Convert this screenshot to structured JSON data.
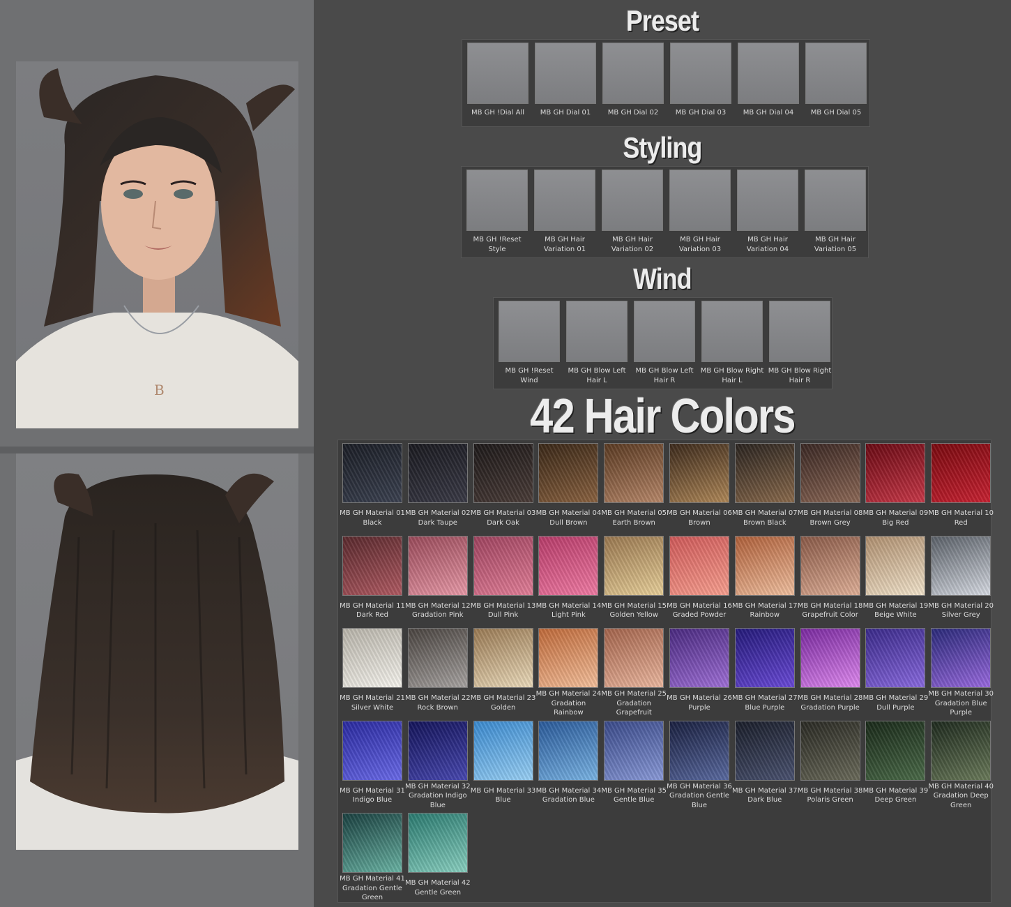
{
  "headings": {
    "preset": "Preset",
    "styling": "Styling",
    "wind": "Wind",
    "colors": "42 Hair Colors"
  },
  "preset": [
    {
      "label": "MB GH !Dial All"
    },
    {
      "label": "MB GH Dial 01"
    },
    {
      "label": "MB GH Dial 02"
    },
    {
      "label": "MB GH Dial 03"
    },
    {
      "label": "MB GH Dial 04"
    },
    {
      "label": "MB GH Dial 05"
    }
  ],
  "styling": [
    {
      "line1": "MB GH !Reset",
      "line2": "Style"
    },
    {
      "line1": "MB GH Hair",
      "line2": "Variation 01"
    },
    {
      "line1": "MB GH Hair",
      "line2": "Variation 02"
    },
    {
      "line1": "MB GH Hair",
      "line2": "Variation 03"
    },
    {
      "line1": "MB GH Hair",
      "line2": "Variation 04"
    },
    {
      "line1": "MB GH Hair",
      "line2": "Variation 05"
    }
  ],
  "wind": [
    {
      "line1": "MB GH !Reset",
      "line2": "Wind"
    },
    {
      "line1": "MB GH Blow Left",
      "line2": "Hair L"
    },
    {
      "line1": "MB GH Blow Left",
      "line2": "Hair R"
    },
    {
      "line1": "MB GH Blow Right",
      "line2": "Hair L"
    },
    {
      "line1": "MB GH Blow Right",
      "line2": "Hair R"
    }
  ],
  "colors": [
    {
      "lines": [
        "MB GH Material 01",
        "Black"
      ],
      "c1": "#1b1e26",
      "c2": "#3b4150"
    },
    {
      "lines": [
        "MB GH Material 02",
        "Dark Taupe"
      ],
      "c1": "#1a1a20",
      "c2": "#3a3a46"
    },
    {
      "lines": [
        "MB GH Material 03",
        "Dark Oak"
      ],
      "c1": "#1e1a1a",
      "c2": "#4a3c38"
    },
    {
      "lines": [
        "MB GH Material 04",
        "Dull Brown"
      ],
      "c1": "#3a2818",
      "c2": "#8a6240"
    },
    {
      "lines": [
        "MB GH Material 05",
        "Earth Brown"
      ],
      "c1": "#5a3a22",
      "c2": "#b8886a"
    },
    {
      "lines": [
        "MB GH Material 06",
        "Brown"
      ],
      "c1": "#3c2a1c",
      "c2": "#b08858"
    },
    {
      "lines": [
        "MB GH Material 07",
        "Brown Black"
      ],
      "c1": "#2a2420",
      "c2": "#8a6a4c"
    },
    {
      "lines": [
        "MB GH Material 08",
        "Brown Grey"
      ],
      "c1": "#3a2824",
      "c2": "#8c6856"
    },
    {
      "lines": [
        "MB GH Material 09",
        "Big Red"
      ],
      "c1": "#6a0a14",
      "c2": "#c83848"
    },
    {
      "lines": [
        "MB GH Material 10",
        "Red"
      ],
      "c1": "#7a0a10",
      "c2": "#c82232"
    },
    {
      "lines": [
        "MB GH Material 11",
        "Dark Red"
      ],
      "c1": "#5a2a2e",
      "c2": "#b05a62"
    },
    {
      "lines": [
        "MB GH Material 12",
        "Gradation Pink"
      ],
      "c1": "#9a4a5a",
      "c2": "#e89aa8"
    },
    {
      "lines": [
        "MB GH Material 13",
        "Dull Pink"
      ],
      "c1": "#a04460",
      "c2": "#e27f98"
    },
    {
      "lines": [
        "MB GH Material 14",
        "Light Pink"
      ],
      "c1": "#b83c6a",
      "c2": "#f07ca4"
    },
    {
      "lines": [
        "MB GH Material 15",
        "Golden Yellow"
      ],
      "c1": "#9a7850",
      "c2": "#e8d09a"
    },
    {
      "lines": [
        "MB GH Material 16",
        "Graded Powder"
      ],
      "c1": "#d05a5a",
      "c2": "#f8a090"
    },
    {
      "lines": [
        "MB GH Material 17",
        "Rainbow"
      ],
      "c1": "#b0603a",
      "c2": "#f0c0a0"
    },
    {
      "lines": [
        "MB GH Material 18",
        "Grapefruit Color"
      ],
      "c1": "#8a5a48",
      "c2": "#e0b098"
    },
    {
      "lines": [
        "MB GH Material 19",
        "Beige White"
      ],
      "c1": "#b09070",
      "c2": "#f2e4cc"
    },
    {
      "lines": [
        "MB GH Material 20",
        "Silver Grey"
      ],
      "c1": "#5a6068",
      "c2": "#d8dce4"
    },
    {
      "lines": [
        "MB GH Material 21",
        "Silver White"
      ],
      "c1": "#b8b4aa",
      "c2": "#f6f4ee"
    },
    {
      "lines": [
        "MB GH Material 22",
        "Rock Brown"
      ],
      "c1": "#4a4440",
      "c2": "#a8a4a2"
    },
    {
      "lines": [
        "MB GH Material 23",
        "Golden"
      ],
      "c1": "#9a7a54",
      "c2": "#ecdcbc"
    },
    {
      "lines": [
        "MB GH Material 24",
        "Gradation",
        "Rainbow"
      ],
      "c1": "#c06a3a",
      "c2": "#f4c09c"
    },
    {
      "lines": [
        "MB GH Material 25",
        "Gradation",
        "Grapefruit"
      ],
      "c1": "#a4644c",
      "c2": "#ecb8a0"
    },
    {
      "lines": [
        "MB GH Material 26",
        "Purple"
      ],
      "c1": "#4a2a80",
      "c2": "#a070d8"
    },
    {
      "lines": [
        "MB GH Material 27",
        "Blue Purple"
      ],
      "c1": "#241a7a",
      "c2": "#6a4ad8"
    },
    {
      "lines": [
        "MB GH Material 28",
        "Gradation Purple"
      ],
      "c1": "#7a2aa0",
      "c2": "#e08af0"
    },
    {
      "lines": [
        "MB GH Material 29",
        "Dull Purple"
      ],
      "c1": "#3a2a8a",
      "c2": "#8a6ae0"
    },
    {
      "lines": [
        "MB GH Material 30",
        "Gradation Blue",
        "Purple"
      ],
      "c1": "#2a2a7a",
      "c2": "#9a6ae0"
    },
    {
      "lines": [
        "MB GH Material 31",
        "Indigo Blue"
      ],
      "c1": "#2a2aa0",
      "c2": "#6a6ae8"
    },
    {
      "lines": [
        "MB GH Material 32",
        "Gradation Indigo",
        "Blue"
      ],
      "c1": "#14145a",
      "c2": "#4848b0"
    },
    {
      "lines": [
        "MB GH Material 33",
        "Blue"
      ],
      "c1": "#3a8ad0",
      "c2": "#9ad0f4"
    },
    {
      "lines": [
        "MB GH Material 34",
        "Gradation Blue"
      ],
      "c1": "#2a5a9a",
      "c2": "#7ab4e4"
    },
    {
      "lines": [
        "MB GH Material 35",
        "Gentle Blue"
      ],
      "c1": "#3a4a8a",
      "c2": "#8a9ad8"
    },
    {
      "lines": [
        "MB GH Material 36",
        "Gradation Gentle",
        "Blue"
      ],
      "c1": "#1a2040",
      "c2": "#5a6aa0"
    },
    {
      "lines": [
        "MB GH Material 37",
        "Dark Blue"
      ],
      "c1": "#1a1e2a",
      "c2": "#4a5270"
    },
    {
      "lines": [
        "MB GH Material 38",
        "Polaris Green"
      ],
      "c1": "#2a2a24",
      "c2": "#6a6a5a"
    },
    {
      "lines": [
        "MB GH Material 39",
        "Deep Green"
      ],
      "c1": "#1a2a1a",
      "c2": "#4a6a48"
    },
    {
      "lines": [
        "MB GH Material 40",
        "Gradation Deep",
        "Green"
      ],
      "c1": "#1e2a1e",
      "c2": "#6a7a5a"
    },
    {
      "lines": [
        "MB GH Material 41",
        "Gradation Gentle",
        "Green"
      ],
      "c1": "#1a4040",
      "c2": "#6ab4a4"
    },
    {
      "lines": [
        "MB GH Material 42",
        "Gentle Green"
      ],
      "c1": "#2a7a70",
      "c2": "#8ad0c0"
    }
  ]
}
